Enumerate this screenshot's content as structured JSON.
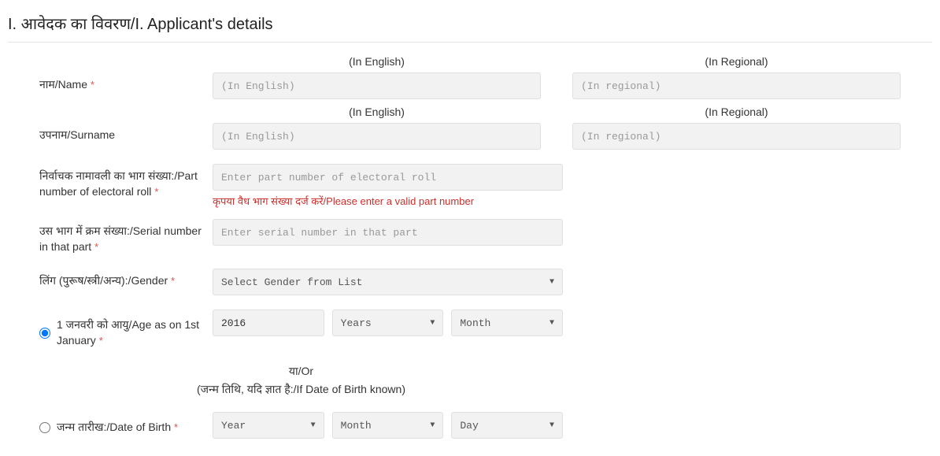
{
  "section_title": "I. आवेदक का विवरण/I. Applicant's details",
  "headers": {
    "english": "(In English)",
    "regional": "(In Regional)"
  },
  "name": {
    "label": "नाम/Name",
    "required_mark": "*",
    "placeholder_en": "(In English)",
    "placeholder_reg": "(In regional)"
  },
  "surname": {
    "label": "उपनाम/Surname",
    "placeholder_en": "(In English)",
    "placeholder_reg": "(In regional)"
  },
  "part_number": {
    "label": "निर्वाचक नामावली का भाग संख्या:/Part number of electoral roll",
    "required_mark": "*",
    "placeholder": "Enter part number of electoral roll",
    "error": "कृपया वैध भाग संख्या दर्ज करें/Please enter a valid part number"
  },
  "serial_number": {
    "label": "उस भाग में क्रम संख्या:/Serial number in that part",
    "required_mark": "*",
    "placeholder": "Enter serial number in that part"
  },
  "gender": {
    "label": "लिंग (पुरूष/स्त्री/अन्य):/Gender",
    "required_mark": "*",
    "selected": "Select Gender from List"
  },
  "age": {
    "radio_label": "1 जनवरी को आयु/Age as on 1st January",
    "required_mark": "*",
    "year_value": "2016",
    "years_select": "Years",
    "month_select": "Month"
  },
  "or_block": {
    "or_text": "या/Or",
    "sub_text": "(जन्म तिथि, यदि ज्ञात है:/If Date of Birth known)"
  },
  "dob": {
    "radio_label": "जन्म तारीख:/Date of Birth",
    "required_mark": "*",
    "year_select": "Year",
    "month_select": "Month",
    "day_select": "Day"
  }
}
